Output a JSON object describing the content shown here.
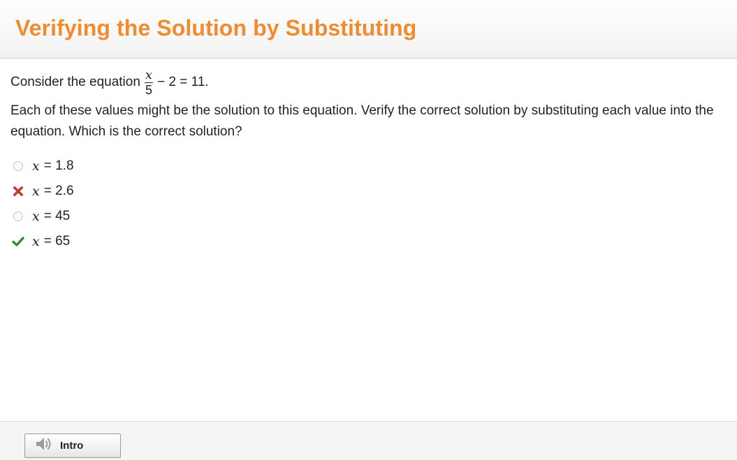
{
  "header": {
    "title": "Verifying the Solution by Substituting"
  },
  "question": {
    "prefix": "Consider the equation",
    "fraction_numerator": "x",
    "fraction_denominator": "5",
    "suffix": "− 2 = 11.",
    "instructions": "Each of these values might be the solution to this equation. Verify the correct solution by substituting each value into the equation. Which is the correct solution?"
  },
  "choices": [
    {
      "variable": "x",
      "text": "= 1.8",
      "status": "unselected"
    },
    {
      "variable": "x",
      "text": "= 2.6",
      "status": "incorrect"
    },
    {
      "variable": "x",
      "text": "= 45",
      "status": "unselected"
    },
    {
      "variable": "x",
      "text": "= 65",
      "status": "correct"
    }
  ],
  "footer": {
    "intro_label": "Intro",
    "intro_icon": "speaker-icon"
  },
  "colors": {
    "title": "#f08c2e",
    "incorrect": "#c0392b",
    "correct": "#2e8b2e"
  }
}
